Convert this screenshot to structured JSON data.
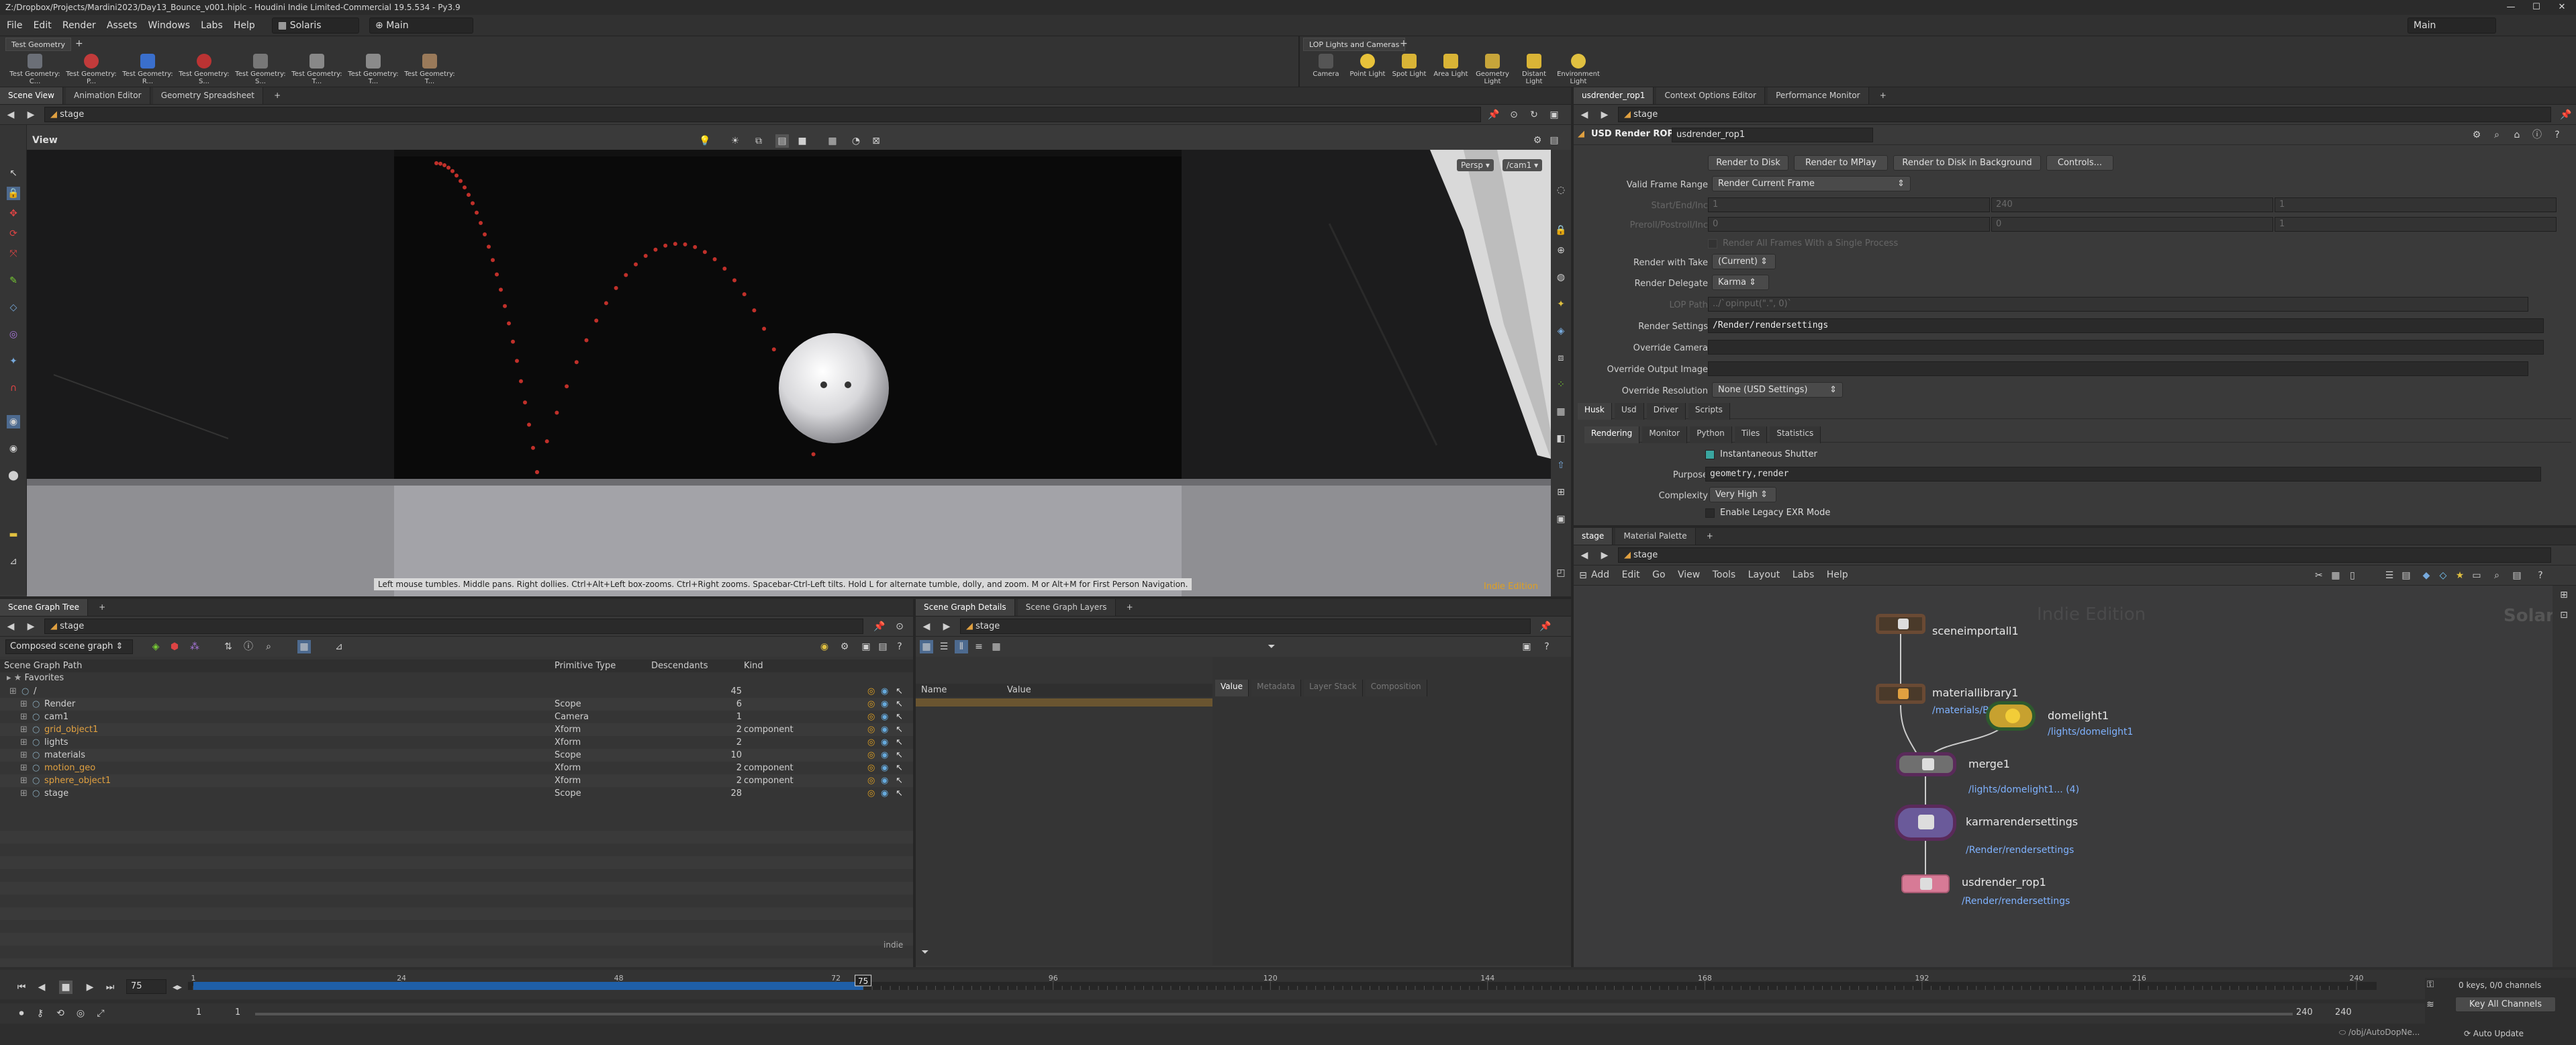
{
  "title_bar": {
    "text": "Z:/Dropbox/Projects/Mardini2023/Day13_Bounce_v001.hiplc - Houdini Indie Limited-Commercial 19.5.534 - Py3.9"
  },
  "menu": [
    "File",
    "Edit",
    "Render",
    "Assets",
    "Windows",
    "Labs",
    "Help"
  ],
  "desktop": "Solaris",
  "context": "Main",
  "desktop_right": "Main",
  "shelf_left": {
    "tab": "Test Geometry",
    "tools": [
      "Test Geometry: C...",
      "Test Geometry: P...",
      "Test Geometry: R...",
      "Test Geometry: S...",
      "Test Geometry: S...",
      "Test Geometry: T...",
      "Test Geometry: T...",
      "Test Geometry: T..."
    ]
  },
  "shelf_right": {
    "tab": "LOP Lights and Cameras",
    "tools": [
      "Camera",
      "Point Light",
      "Spot Light",
      "Area Light",
      "Geometry Light",
      "Distant Light",
      "Environment Light"
    ]
  },
  "viewer": {
    "tabs": [
      "Scene View",
      "Animation Editor",
      "Geometry Spreadsheet"
    ],
    "path": "stage",
    "label": "View",
    "persp": "Persp",
    "cam": "/cam1",
    "hint": "Left mouse tumbles. Middle pans. Right dollies. Ctrl+Alt+Left box-zooms. Ctrl+Right zooms. Spacebar-Ctrl-Left tilts. Hold L for alternate tumble, dolly, and zoom.     M or Alt+M for First Person Navigation.",
    "edition": "Indie Edition"
  },
  "parm_pane": {
    "tabs": [
      "usdrender_rop1",
      "Context Options Editor",
      "Performance Monitor"
    ],
    "path": "stage",
    "node_type": "USD Render ROP",
    "node_name": "usdrender_rop1",
    "buttons": [
      "Render to Disk",
      "Render to MPlay",
      "Render to Disk in Background",
      "Controls..."
    ],
    "valid_frame_range_label": "Valid Frame Range",
    "valid_frame_range": "Render Current Frame",
    "start_end_label": "Start/End/Inc",
    "start_end": [
      "1",
      "240",
      "1"
    ],
    "preroll_label": "Preroll/Postroll/Inc",
    "preroll": [
      "0",
      "0",
      "1"
    ],
    "single_process": "Render All Frames With a Single Process",
    "render_with_take_label": "Render with Take",
    "render_with_take": "(Current)",
    "render_delegate_label": "Render Delegate",
    "render_delegate": "Karma",
    "lop_path_label": "LOP Path",
    "lop_path": "../`opinput(\".\", 0)`",
    "render_settings_label": "Render Settings",
    "render_settings": "/Render/rendersettings",
    "override_camera_label": "Override Camera",
    "override_output_label": "Override Output Image",
    "override_res_label": "Override Resolution",
    "override_res": "None (USD Settings)",
    "subtabs": [
      "Husk",
      "Usd",
      "Driver",
      "Scripts"
    ],
    "subtabs2": [
      "Rendering",
      "Monitor",
      "Python",
      "Tiles",
      "Statistics"
    ],
    "instantaneous_shutter": "Instantaneous Shutter",
    "purpose_label": "Purpose",
    "purpose": "geometry,render",
    "complexity_label": "Complexity",
    "complexity": "Very High",
    "legacy_exr": "Enable Legacy EXR Mode"
  },
  "network": {
    "tabs": [
      "stage",
      "Material Palette"
    ],
    "path": "stage",
    "menu": [
      "Add",
      "Edit",
      "Go",
      "View",
      "Tools",
      "Layout",
      "Labs",
      "Help"
    ],
    "watermark": "Indie Edition",
    "context_label": "Solaris",
    "nodes": [
      {
        "name": "sceneimportall1",
        "sub": ""
      },
      {
        "name": "materiallibrary1",
        "sub": "/materials/BA..."
      },
      {
        "name": "domelight1",
        "sub": "/lights/domelight1"
      },
      {
        "name": "merge1",
        "sub": "/lights/domelight1... (4)"
      },
      {
        "name": "karmarendersettings",
        "sub": "/Render/rendersettings"
      },
      {
        "name": "usdrender_rop1",
        "sub": "/Render/rendersettings"
      }
    ]
  },
  "scene_graph": {
    "tabs": [
      "Scene Graph Tree"
    ],
    "path": "stage",
    "mode": "Composed scene graph",
    "columns": [
      "Scene Graph Path",
      "Primitive Type",
      "Descendants",
      "Kind"
    ],
    "favorites": "Favorites",
    "rows": [
      {
        "name": "/",
        "type": "",
        "desc": "45",
        "kind": "",
        "color": "#d0d0d0"
      },
      {
        "name": "Render",
        "type": "Scope",
        "desc": "6",
        "kind": "",
        "color": "#d0d0d0"
      },
      {
        "name": "cam1",
        "type": "Camera",
        "desc": "1",
        "kind": "",
        "color": "#d0d0d0"
      },
      {
        "name": "grid_object1",
        "type": "Xform",
        "desc": "2",
        "kind": "component",
        "color": "#e0a040"
      },
      {
        "name": "lights",
        "type": "Xform",
        "desc": "2",
        "kind": "",
        "color": "#d0d0d0"
      },
      {
        "name": "materials",
        "type": "Scope",
        "desc": "10",
        "kind": "",
        "color": "#d0d0d0"
      },
      {
        "name": "motion_geo",
        "type": "Xform",
        "desc": "2",
        "kind": "component",
        "color": "#e0a040"
      },
      {
        "name": "sphere_object1",
        "type": "Xform",
        "desc": "2",
        "kind": "component",
        "color": "#e0a040"
      },
      {
        "name": "stage",
        "type": "Scope",
        "desc": "28",
        "kind": "",
        "color": "#d0d0d0"
      }
    ],
    "footer": "indie"
  },
  "details": {
    "tabs": [
      "Scene Graph Details",
      "Scene Graph Layers"
    ],
    "path": "stage",
    "columns": [
      "Name",
      "Value"
    ],
    "value_tabs": [
      "Value",
      "Metadata",
      "Layer Stack",
      "Composition"
    ]
  },
  "timeline": {
    "frame": "75",
    "ticks": [
      "1",
      "24",
      "48",
      "72",
      "96",
      "120",
      "144",
      "168",
      "192",
      "216",
      "240"
    ],
    "start": "1",
    "start2": "1",
    "end": "240",
    "end2": "240",
    "keys": "0 keys, 0/0 channels",
    "key_all": "Key All Channels",
    "obj_path": "/obj/AutoDopNe...",
    "auto_update": "Auto Update"
  }
}
